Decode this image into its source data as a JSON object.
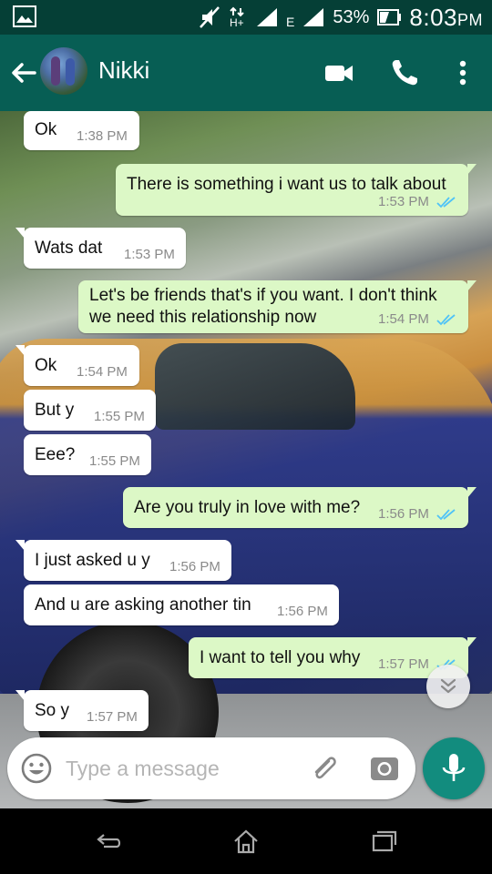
{
  "status_bar": {
    "network_label": "E",
    "battery": "53%",
    "time": "8:03",
    "ampm": "PM"
  },
  "header": {
    "contact_name": "Nikki"
  },
  "messages": [
    {
      "dir": "in",
      "text": "Ok",
      "time": "1:38 PM"
    },
    {
      "dir": "out",
      "text": "There is something i want us to talk about",
      "time": "1:53 PM",
      "read": true
    },
    {
      "dir": "in",
      "text": "Wats dat",
      "time": "1:53 PM"
    },
    {
      "dir": "out",
      "text_line1": "Let's be friends that's if you want. I don't think",
      "text_line2": "we need this relationship now",
      "time": "1:54 PM",
      "read": true
    },
    {
      "dir": "in",
      "text": "Ok",
      "time": "1:54 PM"
    },
    {
      "dir": "in",
      "text": "But y",
      "time": "1:55 PM"
    },
    {
      "dir": "in",
      "text": "Eee?",
      "time": "1:55 PM"
    },
    {
      "dir": "out",
      "text": "Are you truly in love with me?",
      "time": "1:56 PM",
      "read": true
    },
    {
      "dir": "in",
      "text": "I just asked u y",
      "time": "1:56 PM"
    },
    {
      "dir": "in",
      "text": "And u are asking another tin",
      "time": "1:56 PM"
    },
    {
      "dir": "out",
      "text": "I want to tell you why",
      "time": "1:57 PM",
      "read": true
    },
    {
      "dir": "in",
      "text": "So y",
      "time": "1:57 PM"
    }
  ],
  "composer": {
    "placeholder": "Type a message"
  },
  "colors": {
    "header": "#075e54",
    "status_bar": "#053f36",
    "outgoing_bubble": "#dcf8c6",
    "incoming_bubble": "#ffffff",
    "read_ticks": "#4fc3f7",
    "mic_button": "#128c7e"
  },
  "icons": {
    "back": "arrow-left-icon",
    "video": "video-camera-icon",
    "call": "phone-icon",
    "menu": "more-vertical-icon",
    "emoji": "smiley-icon",
    "attach": "paperclip-icon",
    "camera": "camera-icon",
    "mic": "microphone-icon",
    "scroll_down": "double-chevron-down-icon"
  }
}
